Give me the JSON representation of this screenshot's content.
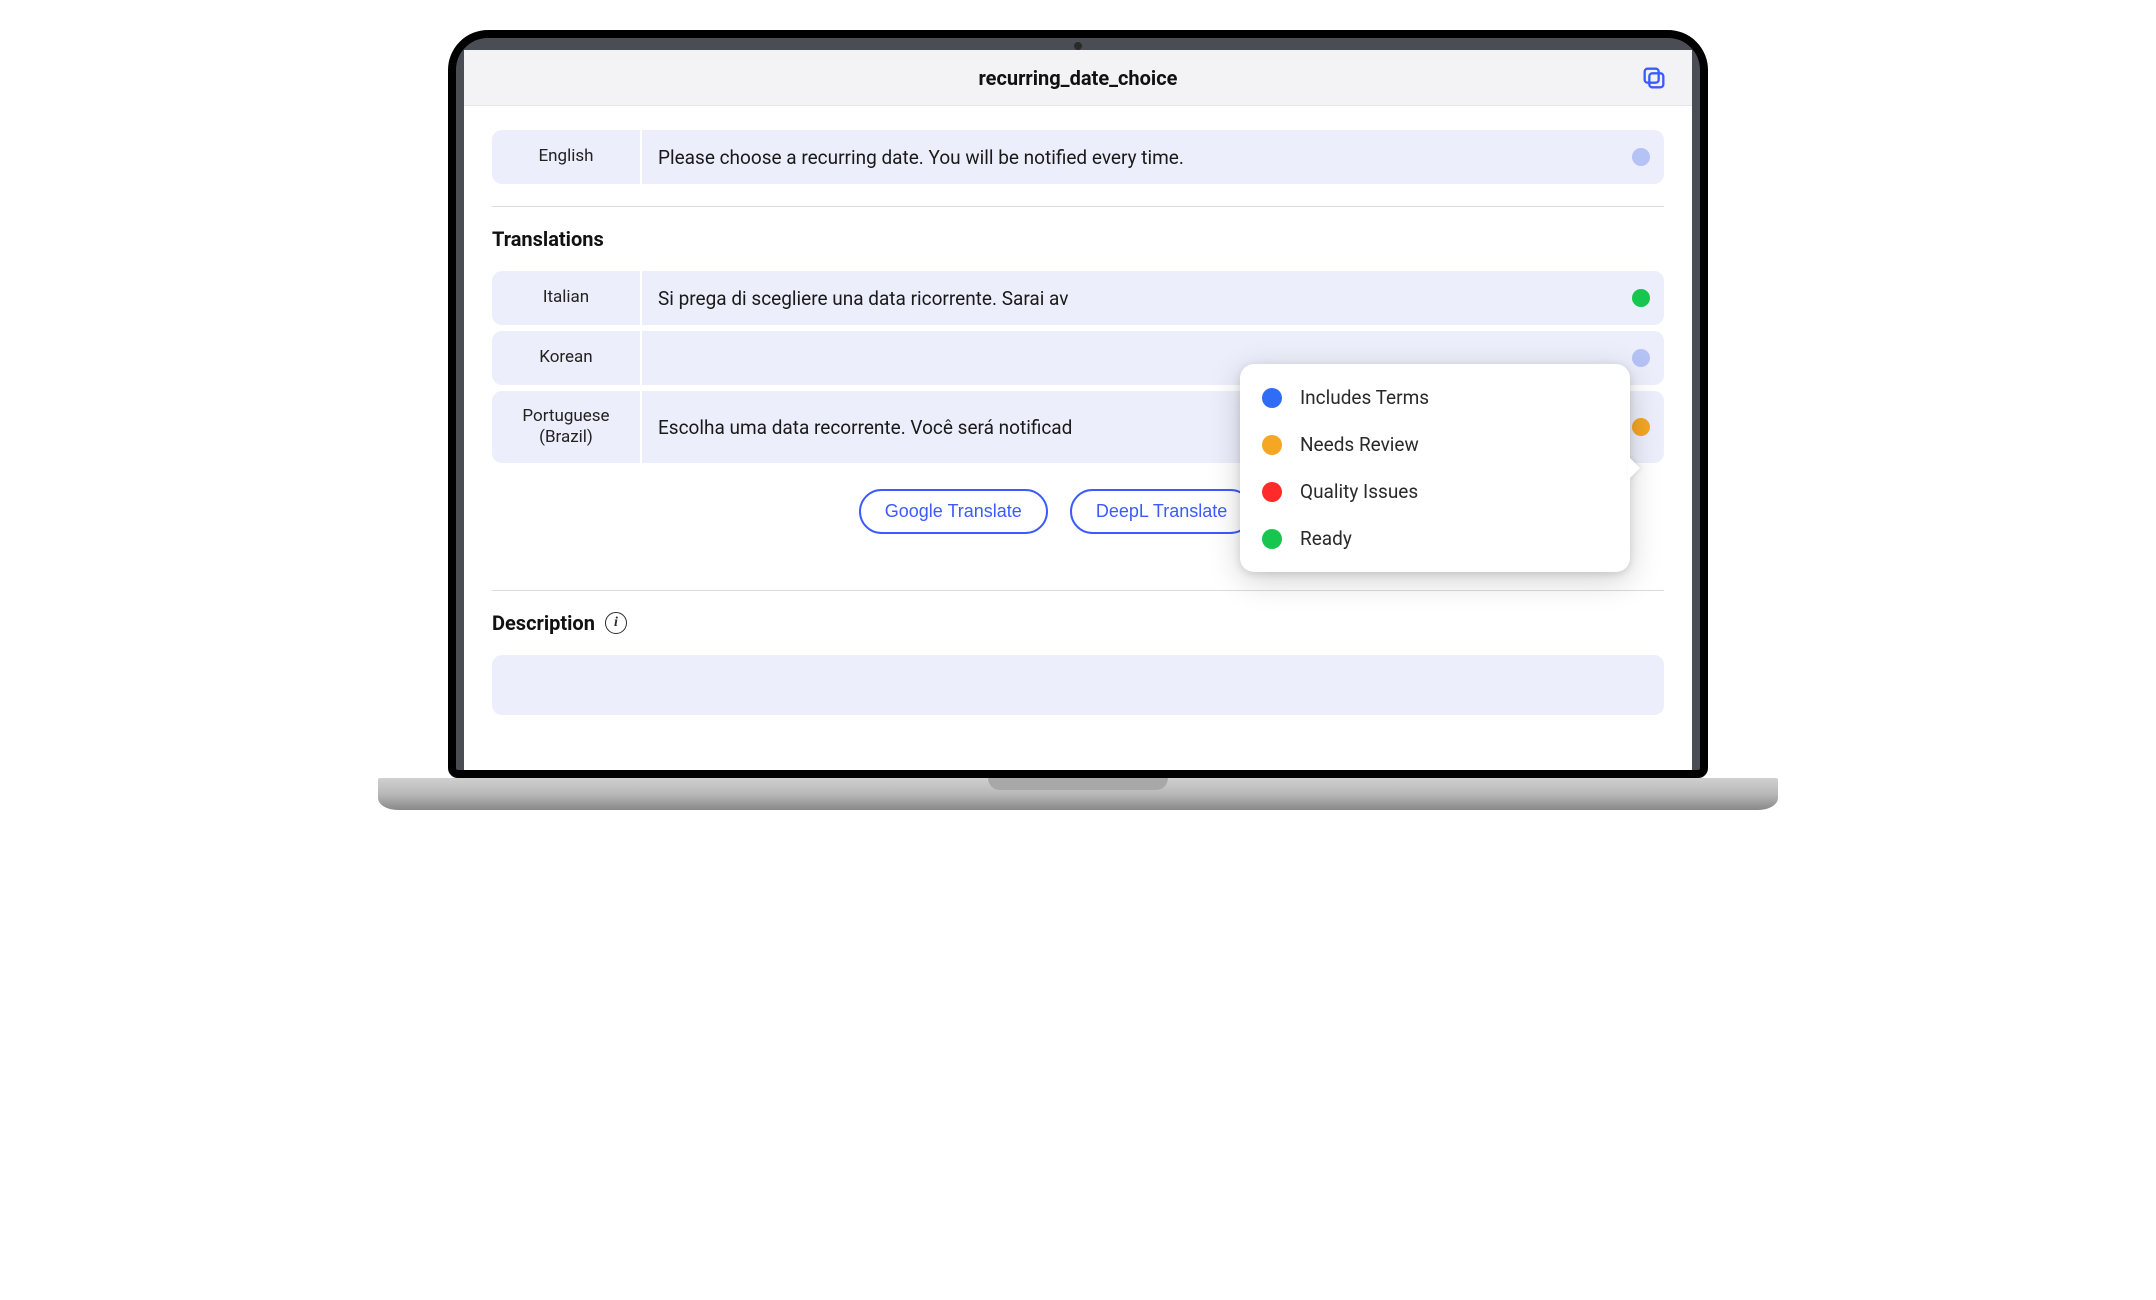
{
  "header": {
    "title": "recurring_date_choice"
  },
  "source": {
    "language_label": "English",
    "text": "Please choose a recurring date. You will be notified every time.",
    "status_color": "#b4c2f6"
  },
  "sections": {
    "translations_label": "Translations",
    "description_label": "Description"
  },
  "translations": [
    {
      "language_label": "Italian",
      "text": "Si prega di scegliere una data ricorrente. Sarai av",
      "status_color": "#17c64f"
    },
    {
      "language_label": "Korean",
      "text": "",
      "status_color": "#b4c2f6"
    },
    {
      "language_label": "Portuguese (Brazil)",
      "text": "Escolha uma data recorrente. Você será notificad",
      "status_color": "#f5a623"
    }
  ],
  "actions": {
    "google_translate": "Google Translate",
    "deepl_translate": "DeepL Translate"
  },
  "status_menu": {
    "items": [
      {
        "label": "Includes Terms",
        "color": "#2f6df6"
      },
      {
        "label": "Needs Review",
        "color": "#f5a623"
      },
      {
        "label": "Quality Issues",
        "color": "#ff2a2a"
      },
      {
        "label": "Ready",
        "color": "#17c64f"
      }
    ]
  },
  "colors": {
    "accent": "#3b5bff",
    "row_bg": "#eceefb"
  }
}
